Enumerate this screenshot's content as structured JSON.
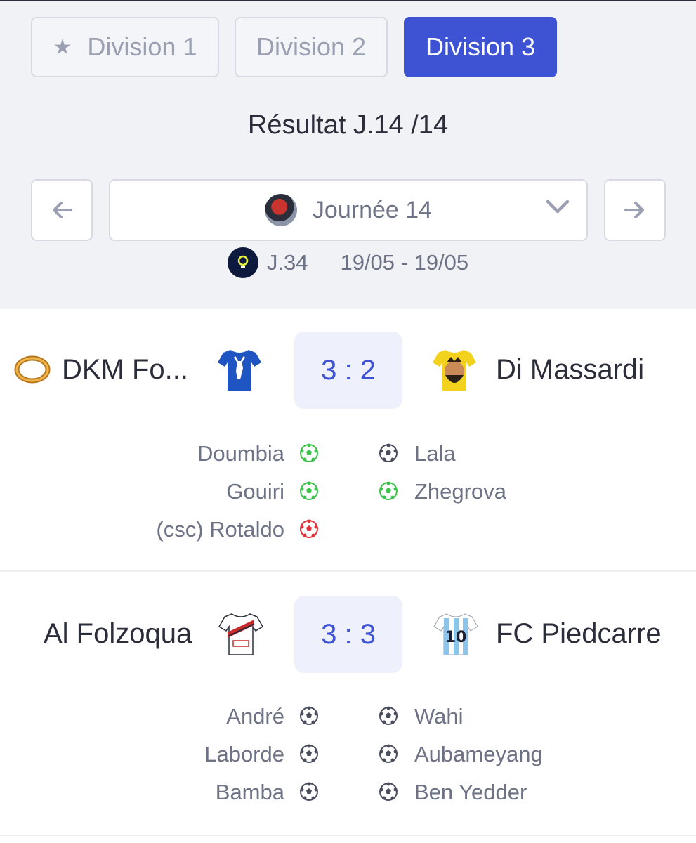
{
  "tabs": [
    {
      "label": "Division 1",
      "icon": "star-icon",
      "active": false
    },
    {
      "label": "Division 2",
      "active": false
    },
    {
      "label": "Division 3",
      "active": true
    }
  ],
  "result_title": "Résultat J.14 /14",
  "journee": {
    "selected": "Journée 14",
    "league_round": "J.34",
    "dates": "19/05 - 19/05"
  },
  "matches": [
    {
      "home": {
        "name": "DKM Fo...",
        "badge": "ring-icon",
        "jersey": "blue-jersey-goat"
      },
      "away": {
        "name": "Di Massardi",
        "jersey": "yellow-jersey-player"
      },
      "score": "3 : 2",
      "home_scorers": [
        {
          "name": "Doumbia",
          "type": "goal"
        },
        {
          "name": "Gouiri",
          "type": "goal"
        },
        {
          "name": "(csc) Rotaldo",
          "type": "own-goal"
        }
      ],
      "away_scorers": [
        {
          "name": "Lala",
          "type": "bonus"
        },
        {
          "name": "Zhegrova",
          "type": "goal"
        }
      ]
    },
    {
      "home": {
        "name": "Al Folzoqua",
        "jersey": "white-red-jersey"
      },
      "away": {
        "name": "FC Piedcarre",
        "jersey": "argentina-jersey-10"
      },
      "score": "3 : 3",
      "home_scorers": [
        {
          "name": "André",
          "type": "bonus"
        },
        {
          "name": "Laborde",
          "type": "bonus"
        },
        {
          "name": "Bamba",
          "type": "bonus"
        }
      ],
      "away_scorers": [
        {
          "name": "Wahi",
          "type": "bonus"
        },
        {
          "name": "Aubameyang",
          "type": "bonus"
        },
        {
          "name": "Ben Yedder",
          "type": "bonus"
        }
      ]
    }
  ],
  "colors": {
    "accent": "#3d53d4",
    "goal": "#3cc24b",
    "own_goal": "#e0303a",
    "bonus": "#4a4d5c"
  }
}
